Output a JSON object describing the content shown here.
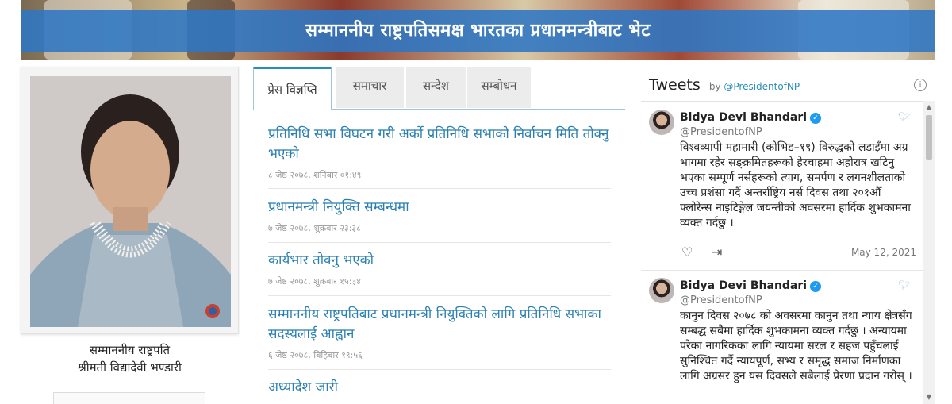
{
  "banner": {
    "title": "सम्माननीय राष्ट्रपतिसमक्ष भारतका प्रधानमन्त्रीबाट भेट"
  },
  "profile": {
    "line1": "सम्माननीय राष्ट्रपति",
    "line2": "श्रीमती विद्यादेवी भण्डारी"
  },
  "tabs": [
    {
      "label": "प्रेस विज्ञप्ति",
      "active": true
    },
    {
      "label": "समाचार",
      "active": false
    },
    {
      "label": "सन्देश",
      "active": false
    },
    {
      "label": "सम्बोधन",
      "active": false
    }
  ],
  "news": [
    {
      "title": "प्रतिनिधि सभा विघटन गरी अर्को प्रतिनिधि सभाको निर्वाचन मिति तोक्नु भएको",
      "date": "८ जेष्ठ २०७८, शनिबार ०१:४९"
    },
    {
      "title": "प्रधानमन्त्री नियुक्ति सम्बन्धमा",
      "date": "७ जेष्ठ २०७८, शुक्रबार २३:३८"
    },
    {
      "title": "कार्यभार तोक्नु भएको",
      "date": "७ जेष्ठ २०७८, शुक्रबार १५:३४"
    },
    {
      "title": "सम्माननीय राष्ट्रपतिबाट प्रधानमन्त्री नियुक्तिको लागि प्रतिनिधि सभाका सदस्यलाई आह्वान",
      "date": "६ जेष्ठ २०७८, बिहिबार १९:५६"
    },
    {
      "title": "अध्यादेश जारी",
      "date": ""
    }
  ],
  "tweets_widget": {
    "heading": "Tweets",
    "by_prefix": "by",
    "by_handle": "@PresidentofNP",
    "info_icon": "info-icon",
    "tweets": [
      {
        "name": "Bidya Devi Bhandari",
        "handle": "@PresidentofNP",
        "text": "विश्वव्यापी महामारी (कोभिड–१९) विरुद्धको लडाइँमा अग्र भागमा रहेर सङ्क्रमितहरूको हेरचाहमा अहोरात्र खटिनु भएका सम्पूर्ण नर्सहरूको त्याग, समर्पण र लगनशीलताको उच्च प्रशंसा गर्दै अन्तर्राष्ट्रिय नर्स दिवस तथा २०१औँ फ्लोरेन्स नाइटिङ्गेल जयन्तीको अवसरमा हार्दिक शुभकामना व्यक्त गर्दछु ।",
        "date": "May 12, 2021"
      },
      {
        "name": "Bidya Devi Bhandari",
        "handle": "@PresidentofNP",
        "text": "कानुन दिवस २०७८ को अवसरमा कानुन तथा न्याय क्षेत्रसँग सम्बद्ध सबैमा हार्दिक शुभकामना व्यक्त गर्दछु । अन्यायमा परेका नागरिकका लागि न्यायमा सरल र सहज पहुँचलाई सुनिश्चित गर्दै न्यायपूर्ण, सभ्य र समृद्ध समाज निर्माणका लागि अग्रसर हुन यस दिवसले सबैलाई प्रेरणा प्रदान गरोस् ।",
        "date": ""
      }
    ]
  },
  "colors": {
    "accent": "#2a8db8",
    "link": "#2a7fb0",
    "banner_stripe": "#2e76c4",
    "verified": "#1d9bf0"
  }
}
